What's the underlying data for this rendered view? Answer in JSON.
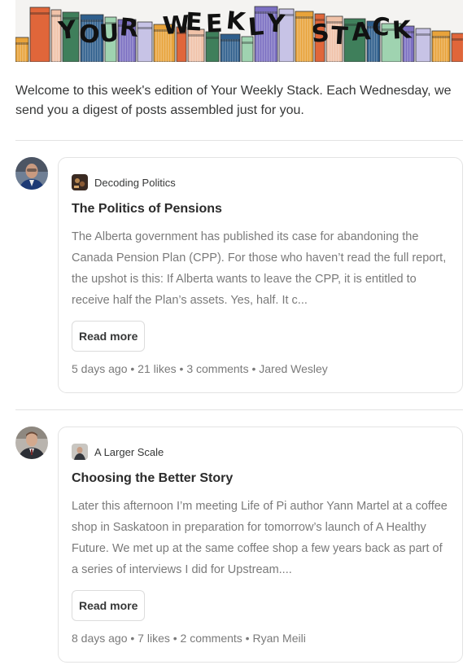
{
  "banner": {
    "letters": [
      "Y",
      "O",
      "U",
      "R",
      "W",
      "E",
      "E",
      "K",
      "L",
      "Y",
      "S",
      "T",
      "A",
      "C",
      "K"
    ]
  },
  "intro": "Welcome to this week's edition of Your Weekly Stack. Each Wednesday, we send you a digest of posts assembled just for you.",
  "posts": [
    {
      "publication": "Decoding Politics",
      "title": "The Politics of Pensions",
      "excerpt": "The Alberta government has published its case for abandoning the Canada Pension Plan (CPP). For those who haven’t read the full report, the upshot is this: If Alberta wants to leave the CPP, it is entitled to receive half the Plan’s assets. Yes, half. It c...",
      "read_more": "Read more",
      "meta": "5 days ago • 21 likes • 3 comments • Jared Wesley"
    },
    {
      "publication": "A Larger Scale",
      "title": "Choosing the Better Story",
      "excerpt": "Later this afternoon I’m meeting Life of Pi author Yann Martel at a coffee shop in Saskatoon in preparation for tomorrow’s launch of A Healthy Future. We met up at the same coffee shop a few years back as part of a series of interviews I did for Upstream....",
      "read_more": "Read more",
      "meta": "8 days ago • 7 likes • 2 comments • Ryan Meili"
    }
  ],
  "colors": {
    "book_palette": [
      "#e8a33a",
      "#3f7f5b",
      "#7b6fc2",
      "#e0663a",
      "#2e5e8c",
      "#c7c3e6",
      "#f0c2a8",
      "#9fd3b0"
    ]
  }
}
